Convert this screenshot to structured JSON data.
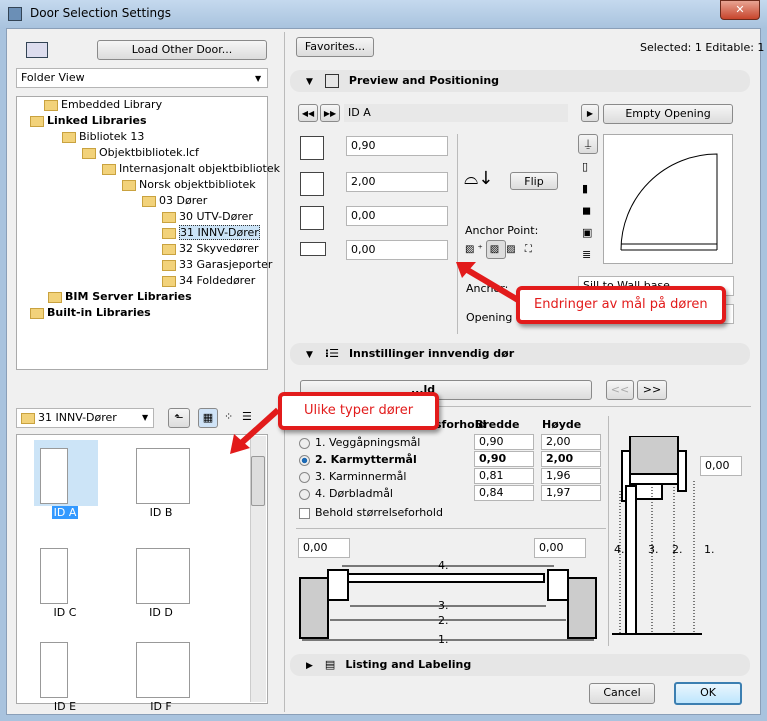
{
  "window": {
    "title": "Door Selection Settings",
    "close": "✕"
  },
  "left": {
    "load_other": "Load Other Door...",
    "view_select": "Folder View",
    "tree": [
      {
        "label": "Embedded Library",
        "bold": false
      },
      {
        "label": "Linked Libraries",
        "bold": true
      },
      {
        "label": "Bibliotek 13",
        "bold": false
      },
      {
        "label": "Objektbibliotek.lcf",
        "bold": false
      },
      {
        "label": "Internasjonalt objektbibliotek",
        "bold": false
      },
      {
        "label": "Norsk objektbibliotek",
        "bold": false
      },
      {
        "label": "03 Dører",
        "bold": false
      },
      {
        "label": "30 UTV-Dører",
        "bold": false
      },
      {
        "label": "31 INNV-Dører",
        "bold": false,
        "selected": true
      },
      {
        "label": "32 Skyvedører",
        "bold": false
      },
      {
        "label": "33 Garasjeporter",
        "bold": false
      },
      {
        "label": "34 Foldedører",
        "bold": false
      },
      {
        "label": "BIM Server Libraries",
        "bold": true
      },
      {
        "label": "Built-in Libraries",
        "bold": true
      }
    ],
    "folder_select": "31 INNV-Dører",
    "items": [
      {
        "label": "ID A",
        "selected": true
      },
      {
        "label": "ID B"
      },
      {
        "label": "ID C"
      },
      {
        "label": "ID D"
      },
      {
        "label": "ID E"
      },
      {
        "label": "ID F"
      }
    ]
  },
  "right": {
    "favorites": "Favorites...",
    "selected_info": "Selected: 1 Editable: 1",
    "preview_section": "Preview and Positioning",
    "object_name": "ID A",
    "empty_opening": "Empty Opening",
    "width": "0,90",
    "height": "2,00",
    "sill": "0,00",
    "offset": "0,00",
    "flip": "Flip",
    "anchor_point": "Anchor Point:",
    "anchor_label": "Anchor:",
    "anchor_value": "Sill to Wall base",
    "opening_label": "Opening F",
    "settings_section": "Innstillinger innvendig dør",
    "page_select": "...ld",
    "prev": "<<",
    "next": ">>",
    "dims_header": "...esforhold",
    "col_w": "Bredde",
    "col_h": "Høyde",
    "rows": [
      {
        "label": "1. Veggåpningsmål",
        "w": "0,90",
        "h": "2,00",
        "checked": false
      },
      {
        "label": "2. Karmyttermål",
        "w": "0,90",
        "h": "2,00",
        "checked": true
      },
      {
        "label": "3. Karminnermål",
        "w": "0,81",
        "h": "1,96",
        "checked": false
      },
      {
        "label": "4. Dørbladmål",
        "w": "0,84",
        "h": "1,97",
        "checked": false
      }
    ],
    "keep_ratio": "Behold størrelseforhold",
    "side_value": "0,00",
    "left_value": "0,00",
    "right_value": "0,00",
    "dim_labels": [
      "4.",
      "3.",
      "2.",
      "1."
    ],
    "listing_section": "Listing and Labeling",
    "cancel": "Cancel",
    "ok": "OK"
  },
  "callouts": {
    "left": "Ulike typer dører",
    "right": "Endringer av mål på døren"
  },
  "colors": {
    "callout": "#e21b1b",
    "selection": "#cce4f7"
  }
}
